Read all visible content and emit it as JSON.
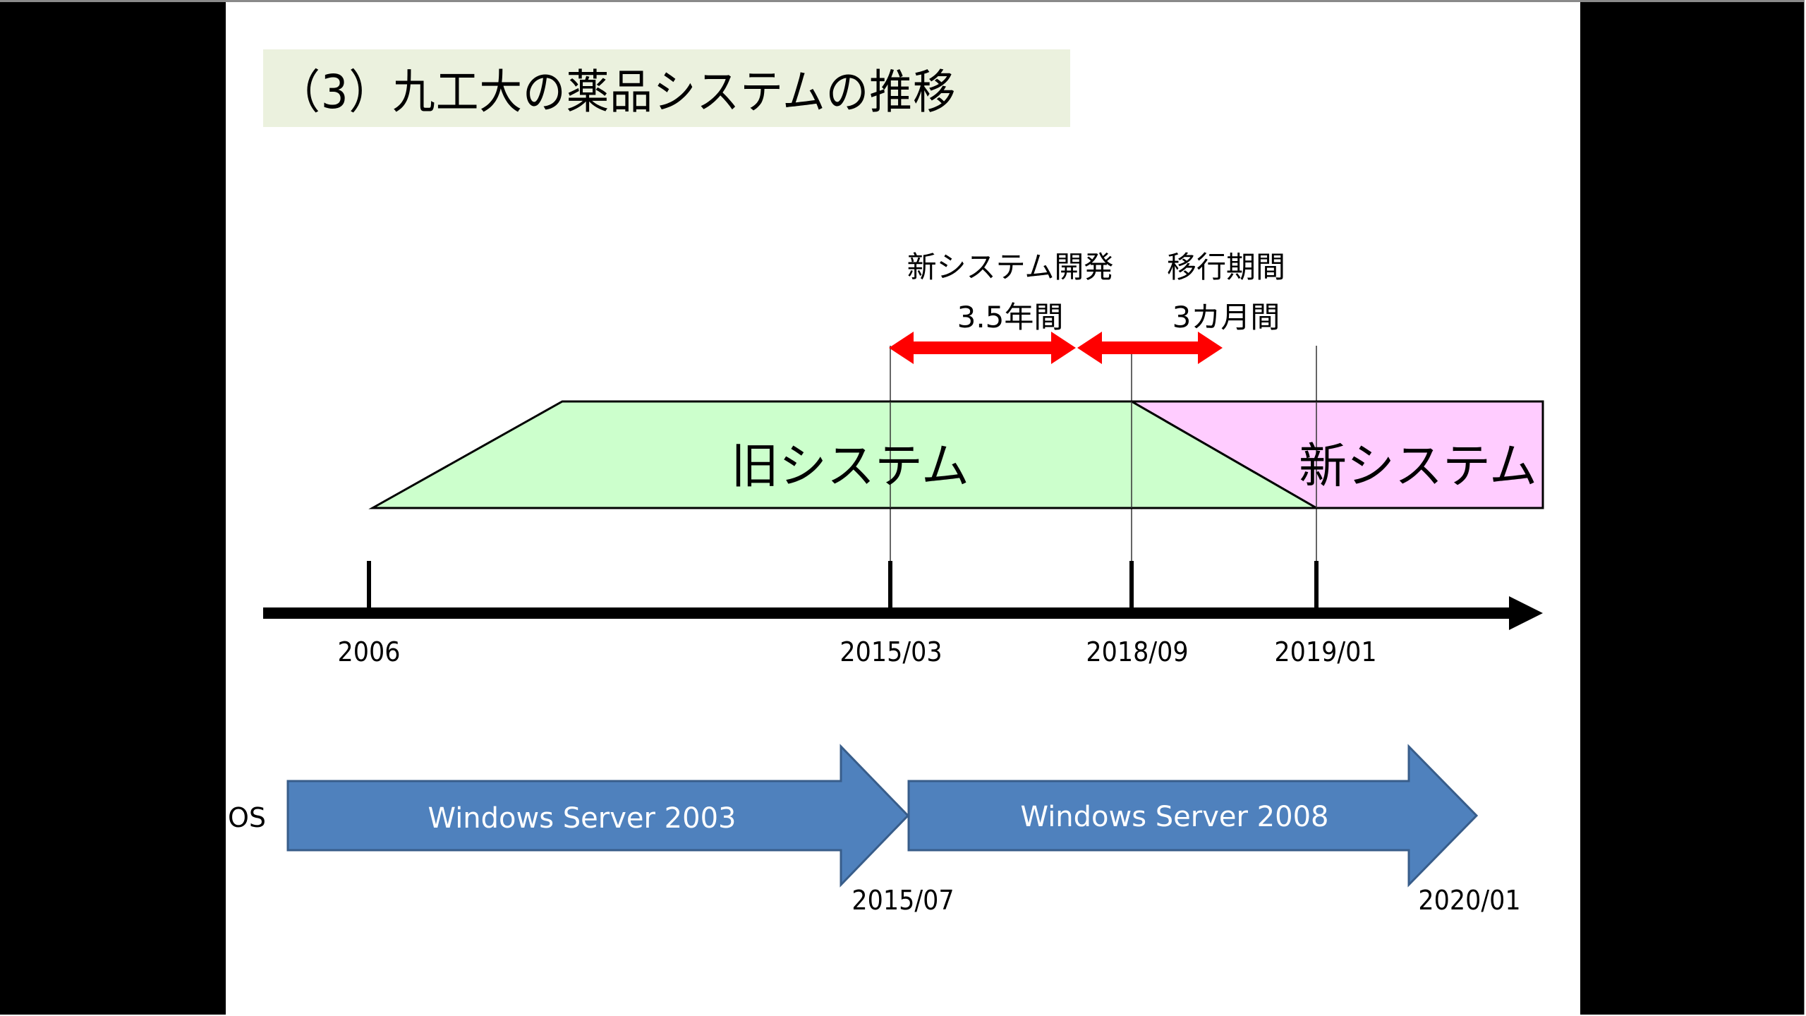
{
  "slide": {
    "title": "（3）九工大の薬品システムの推移",
    "colors": {
      "title_bg": "#ebf1de",
      "old_system_fill": "#ccffcc",
      "new_system_fill": "#ffccff",
      "period_arrow": "#ff0000",
      "os_arrow_fill": "#4f81bd",
      "os_arrow_stroke": "#385d8a"
    },
    "periods": [
      {
        "line1": "新システム開発",
        "line2": "3.5年間",
        "from": "2015/03",
        "to": "2018/09"
      },
      {
        "line1": "移行期間",
        "line2": "3カ月間",
        "from": "2018/09",
        "to": "2019/01"
      }
    ],
    "systems": {
      "old": {
        "label": "旧システム",
        "start": "2006",
        "end": "2019/01"
      },
      "new": {
        "label": "新システム",
        "start": "2018/09"
      }
    },
    "timeline": {
      "ticks": [
        "2006",
        "2015/03",
        "2018/09",
        "2019/01"
      ]
    },
    "os": {
      "label": "OS",
      "versions": [
        {
          "name": "Windows Server 2003",
          "end_date": "2015/07"
        },
        {
          "name": "Windows Server 2008",
          "end_date": "2020/01"
        }
      ]
    }
  }
}
